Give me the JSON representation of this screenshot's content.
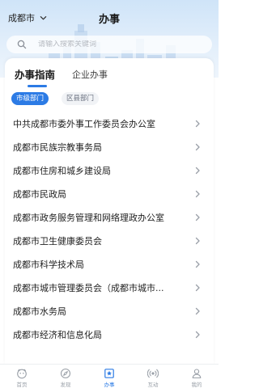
{
  "header": {
    "city": "成都市",
    "title": "办事"
  },
  "search": {
    "placeholder": "请输入搜索关键词"
  },
  "tabs": [
    {
      "label": "办事指南"
    },
    {
      "label": "企业办事"
    }
  ],
  "filters": [
    {
      "label": "市级部门"
    },
    {
      "label": "区县部门"
    }
  ],
  "departments": [
    "中共成都市委外事工作委员会办公室",
    "成都市民族宗教事务局",
    "成都市住房和城乡建设局",
    "成都市民政局",
    "成都市政务服务管理和网络理政办公室",
    "成都市卫生健康委员会",
    "成都市科学技术局",
    "成都市城市管理委员会（成都市城市...",
    "成都市水务局",
    "成都市经济和信息化局"
  ],
  "bottom_nav": [
    {
      "label": "首页",
      "icon": "home-icon"
    },
    {
      "label": "发现",
      "icon": "compass-icon"
    },
    {
      "label": "办事",
      "icon": "service-icon"
    },
    {
      "label": "互动",
      "icon": "broadcast-icon"
    },
    {
      "label": "我的",
      "icon": "user-icon"
    }
  ],
  "colors": {
    "accent": "#2c7be5"
  }
}
